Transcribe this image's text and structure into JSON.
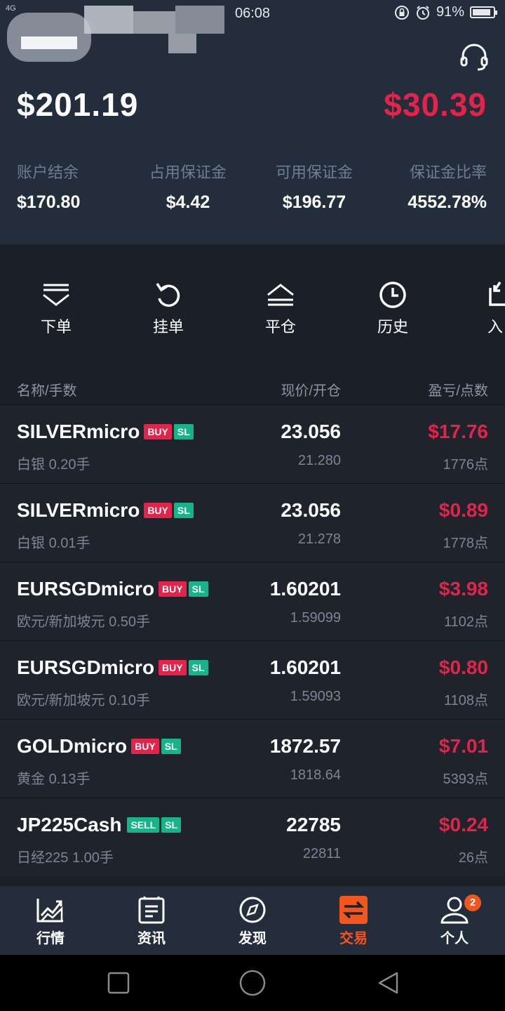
{
  "status_bar": {
    "network": "4G",
    "time": "06:08",
    "battery": "91%"
  },
  "account": {
    "equity": "$201.19",
    "floating_pnl": "$30.39",
    "stats": [
      {
        "label": "账户结余",
        "value": "$170.80"
      },
      {
        "label": "占用保证金",
        "value": "$4.42"
      },
      {
        "label": "可用保证金",
        "value": "$196.77"
      },
      {
        "label": "保证金比率",
        "value": "4552.78%"
      }
    ]
  },
  "actions": [
    {
      "label": "下单",
      "icon": "place-order-icon"
    },
    {
      "label": "挂单",
      "icon": "pending-order-icon"
    },
    {
      "label": "平仓",
      "icon": "close-position-icon"
    },
    {
      "label": "历史",
      "icon": "history-icon"
    },
    {
      "label": "入",
      "icon": "deposit-icon"
    }
  ],
  "table": {
    "headers": {
      "name": "名称/手数",
      "price": "现价/开仓",
      "profit": "盈亏/点数"
    },
    "rows": [
      {
        "symbol": "SILVERmicro",
        "side": "BUY",
        "sl": "SL",
        "name": "白银",
        "lots": "0.20手",
        "price": "23.056",
        "open": "21.280",
        "profit": "$17.76",
        "points": "1776点"
      },
      {
        "symbol": "SILVERmicro",
        "side": "BUY",
        "sl": "SL",
        "name": "白银",
        "lots": "0.01手",
        "price": "23.056",
        "open": "21.278",
        "profit": "$0.89",
        "points": "1778点"
      },
      {
        "symbol": "EURSGDmicro",
        "side": "BUY",
        "sl": "SL",
        "name": "欧元/新加坡元",
        "lots": "0.50手",
        "price": "1.60201",
        "open": "1.59099",
        "profit": "$3.98",
        "points": "1102点"
      },
      {
        "symbol": "EURSGDmicro",
        "side": "BUY",
        "sl": "SL",
        "name": "欧元/新加坡元",
        "lots": "0.10手",
        "price": "1.60201",
        "open": "1.59093",
        "profit": "$0.80",
        "points": "1108点"
      },
      {
        "symbol": "GOLDmicro",
        "side": "BUY",
        "sl": "SL",
        "name": "黄金",
        "lots": "0.13手",
        "price": "1872.57",
        "open": "1818.64",
        "profit": "$7.01",
        "points": "5393点"
      },
      {
        "symbol": "JP225Cash",
        "side": "SELL",
        "sl": "SL",
        "name": "日经225",
        "lots": "1.00手",
        "price": "22785",
        "open": "22811",
        "profit": "$0.24",
        "points": "26点"
      }
    ]
  },
  "tabs": [
    {
      "label": "行情",
      "icon": "market-chart-icon"
    },
    {
      "label": "资讯",
      "icon": "news-icon"
    },
    {
      "label": "发现",
      "icon": "compass-icon"
    },
    {
      "label": "交易",
      "icon": "trade-icon",
      "active": true
    },
    {
      "label": "个人",
      "icon": "person-icon",
      "badge": "2"
    }
  ],
  "colors": {
    "loss_red": "#e3234a",
    "accent_orange": "#f2561d",
    "sl_green": "#18b38a",
    "header_bg": "#242d3c"
  }
}
